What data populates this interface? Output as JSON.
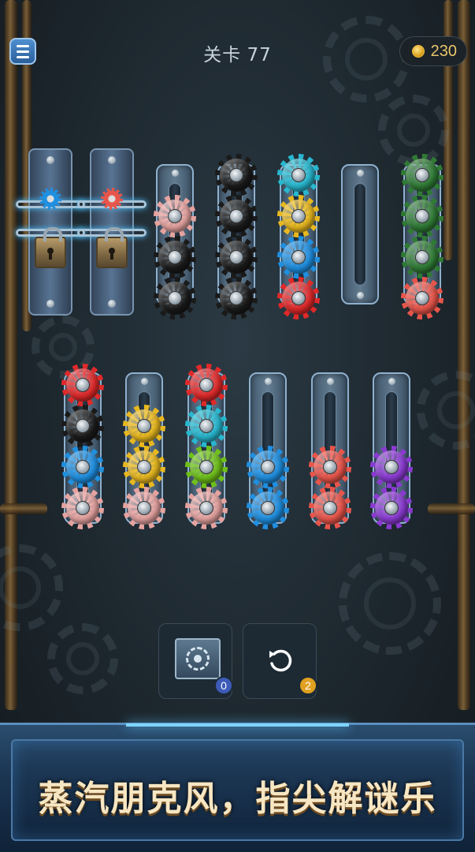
{
  "header": {
    "level_label": "关卡",
    "level_number": "77",
    "coins": "230"
  },
  "gear_colors": {
    "red": "#e02929",
    "black": "#1a1a1a",
    "blue": "#1f8fe0",
    "pink": "#e5a3a0",
    "yellow": "#e8b820",
    "cyan": "#28b7cf",
    "green": "#2f7a34",
    "lime": "#6fc01a",
    "coral": "#e8554a",
    "purple": "#8a3ad1"
  },
  "locked_columns": [
    {
      "preview_gear": "blue"
    },
    {
      "preview_gear": "coral"
    }
  ],
  "columns_top": [
    {
      "gears": [
        "pink",
        "black",
        "black"
      ]
    },
    {
      "gears": [
        "black",
        "black",
        "black",
        "black"
      ]
    },
    {
      "gears": [
        "cyan",
        "yellow",
        "blue",
        "red"
      ]
    },
    {
      "gears": []
    },
    {
      "gears": [
        "green",
        "green",
        "green",
        "coral"
      ]
    }
  ],
  "columns_bottom": [
    {
      "gears": [
        "red",
        "black",
        "blue",
        "pink"
      ]
    },
    {
      "gears": [
        "yellow",
        "yellow",
        "pink"
      ]
    },
    {
      "gears": [
        "red",
        "cyan",
        "lime",
        "pink"
      ]
    },
    {
      "gears": [
        "blue",
        "blue"
      ]
    },
    {
      "gears": [
        "coral",
        "coral"
      ]
    },
    {
      "gears": [
        "purple",
        "purple"
      ]
    }
  ],
  "tools": {
    "vault_count": "0",
    "undo_count": "2",
    "vault_badge_color": "#3d5bb8",
    "undo_badge_color": "#e0a020"
  },
  "banner": {
    "text": "蒸汽朋克风，指尖解谜乐"
  }
}
